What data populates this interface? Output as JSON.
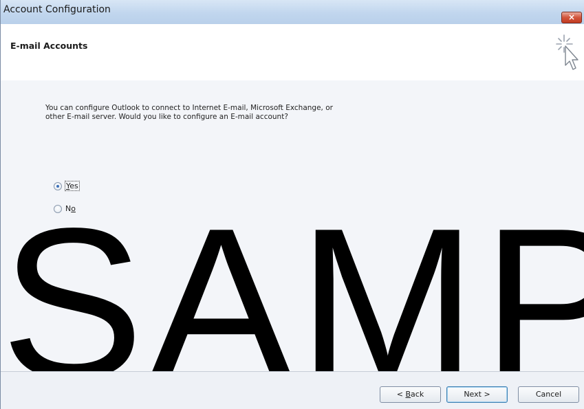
{
  "window": {
    "title": "Account Configuration",
    "close_label": "×"
  },
  "header": {
    "title": "E-mail Accounts",
    "icon": "wizard-cursor-icon"
  },
  "main": {
    "description_line1": "You can configure Outlook to connect to Internet E-mail, Microsoft Exchange, or",
    "description_line2": "other E-mail server. Would you like to configure an E-mail account?",
    "options": [
      {
        "label": "Yes",
        "accel": "Y",
        "rest": "es",
        "selected": true
      },
      {
        "label": "No",
        "accel": "o",
        "prefix": "N",
        "selected": false
      }
    ]
  },
  "watermark": "SAMPLE",
  "footer": {
    "back_label": "< Back",
    "back_prefix": "< ",
    "back_accel": "B",
    "back_rest": "ack",
    "next_label": "Next >",
    "cancel_label": "Cancel"
  },
  "colors": {
    "titlebar": "#c1d6ee",
    "close": "#d2553c",
    "header_bg": "#ffffff",
    "body_bg": "#f3f5f9"
  }
}
